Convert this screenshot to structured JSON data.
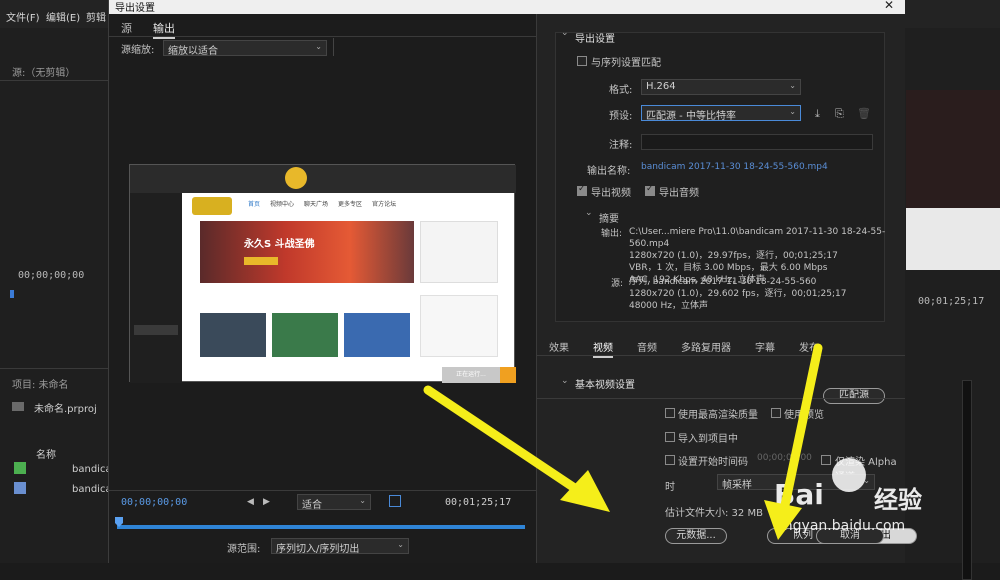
{
  "app": {
    "menu": [
      "文件(F)",
      "编辑(E)",
      "剪辑"
    ],
    "source_panel_label": "源:（无剪辑）",
    "timecode_left": "00;00;00;00",
    "project_label": "项目: 未命名",
    "project_file": "未命名.prproj",
    "name_header": "名称",
    "items": [
      "bandica",
      "bandica"
    ],
    "timecode_right": "00;01;25;17"
  },
  "dialog": {
    "title": "导出设置",
    "close_glyph": "✕"
  },
  "left": {
    "tabs": [
      "源",
      "输出"
    ],
    "source_scaling_label": "源缩放:",
    "source_scaling_value": "缩放以适合",
    "timecode_start": "00;00;00;00",
    "fit_label": "适合",
    "timecode_end": "00;01;25;17",
    "source_range_label": "源范围:",
    "source_range_value": "序列切入/序列切出",
    "preview": {
      "banner_title": "永久S 斗战圣佛",
      "nav": [
        "首页",
        "视频中心",
        "聊天广场",
        "更多专区",
        "官方论坛"
      ],
      "running_btn": "正在运行..."
    }
  },
  "right": {
    "section_title": "导出设置",
    "match_sequence_label": "与序列设置匹配",
    "format_label": "格式:",
    "format_value": "H.264",
    "preset_label": "预设:",
    "preset_value": "匹配源 - 中等比特率",
    "comment_label": "注释:",
    "output_name_label": "输出名称:",
    "output_name_value": "bandicam 2017-11-30 18-24-55-560.mp4",
    "export_video_label": "导出视频",
    "export_audio_label": "导出音频",
    "summary_title": "摘要",
    "output_label": "输出:",
    "output_lines": [
      "C:\\User...miere Pro\\11.0\\bandicam 2017-11-30 18-24-55-560.mp4",
      "1280x720 (1.0)，29.97fps，逐行，00;01;25;17",
      "VBR，1 次，目标 3.00 Mbps，最大 6.00 Mbps",
      "AAC, 192 Kbps, 48 kHz, 立体声"
    ],
    "source_label": "源:",
    "source_lines": [
      "序列, bandicam 2017-11-30 18-24-55-560",
      "1280x720 (1.0)，29.602 fps，逐行，00;01;25;17",
      "48000 Hz，立体声"
    ],
    "tabs": [
      "效果",
      "视频",
      "音频",
      "多路复用器",
      "字幕",
      "发布"
    ],
    "basic_video_settings": "基本视频设置",
    "match_source_btn": "匹配源",
    "max_render_quality": "使用最高渲染质量",
    "use_previews": "使用预览",
    "import_into_project": "导入到项目中",
    "set_start_timecode": "设置开始时间码",
    "start_timecode_value": "00;00;00;00",
    "render_alpha": "仅渲染 Alpha 通道",
    "time_interp_label": "时",
    "time_interp_value": "帧采样",
    "estimated_size": "估计文件大小: 32 MB",
    "metadata_btn": "元数据...",
    "queue_btn": "队列",
    "export_btn": "导出",
    "cancel_btn": "取消"
  },
  "watermark": {
    "brand": "Bai",
    "brand2": "经验",
    "url": "jingyan.baidu.com"
  },
  "colors": {
    "arrow": "#f5ee1a",
    "accent_blue": "#4a8ad8",
    "dialog_bg": "#232323"
  }
}
